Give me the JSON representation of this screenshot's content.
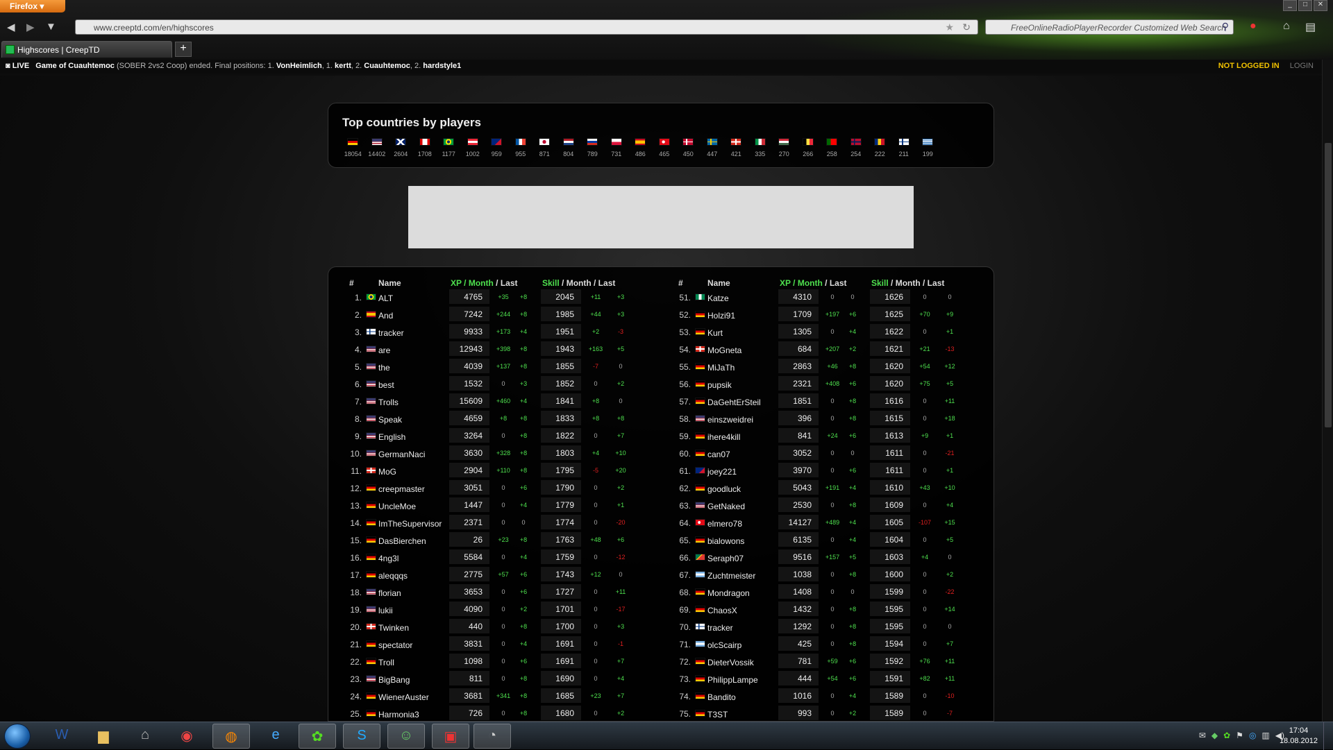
{
  "browser": {
    "menu_label": "Firefox",
    "url": "www.creeptd.com/en/highscores",
    "search_placeholder": "FreeOnlineRadioPlayerRecorder Customized Web Search",
    "tab_title": "Highscores | CreepTD"
  },
  "livebar": {
    "live_label": "LIVE",
    "game_title": "Game of Cuauhtemoc",
    "game_mode": "(SOBER 2vs2 Coop) ended. Final positions: 1.",
    "p1": "VonHeimlich",
    "sep1": ", 1.",
    "p2": "kertt",
    "sep2": ", 2.",
    "p3": "Cuauhtemoc",
    "sep3": ", 2.",
    "p4": "hardstyle1",
    "status": "NOT LOGGED IN",
    "login": "LOGIN"
  },
  "countries": {
    "title": "Top countries by players",
    "items": [
      {
        "flag": "germany",
        "count": "18054"
      },
      {
        "flag": "usa",
        "count": "14402"
      },
      {
        "flag": "uk",
        "count": "2604"
      },
      {
        "flag": "canada",
        "count": "1708"
      },
      {
        "flag": "brazil",
        "count": "1177"
      },
      {
        "flag": "austria",
        "count": "1002"
      },
      {
        "flag": "australia",
        "count": "959"
      },
      {
        "flag": "france",
        "count": "955"
      },
      {
        "flag": "japan",
        "count": "871"
      },
      {
        "flag": "netherlands",
        "count": "804"
      },
      {
        "flag": "russia",
        "count": "789"
      },
      {
        "flag": "poland",
        "count": "731"
      },
      {
        "flag": "spain",
        "count": "486"
      },
      {
        "flag": "turkey",
        "count": "465"
      },
      {
        "flag": "denmark",
        "count": "450"
      },
      {
        "flag": "sweden",
        "count": "447"
      },
      {
        "flag": "switzerland",
        "count": "421"
      },
      {
        "flag": "italy",
        "count": "335"
      },
      {
        "flag": "hungary",
        "count": "270"
      },
      {
        "flag": "belgium",
        "count": "266"
      },
      {
        "flag": "portugal",
        "count": "258"
      },
      {
        "flag": "norway",
        "count": "254"
      },
      {
        "flag": "romania",
        "count": "222"
      },
      {
        "flag": "finland",
        "count": "211"
      },
      {
        "flag": "greece",
        "count": "199"
      }
    ]
  },
  "table_headers": {
    "rank": "#",
    "name": "Name",
    "xp": "XP",
    "slash1": "/",
    "month": "Month",
    "slash2": "/ Last",
    "skill": "Skill",
    "skill_rest": "/ Month / Last"
  },
  "left_rows": [
    {
      "rank": "1.",
      "flag": "brazil",
      "name": "ALT",
      "xp": "4765",
      "xp_month": "+35",
      "xp_last": "+8",
      "skill": "2045",
      "skill_month": "+11",
      "skill_last": "+3"
    },
    {
      "rank": "2.",
      "flag": "spain",
      "name": "And",
      "xp": "7242",
      "xp_month": "+244",
      "xp_last": "+8",
      "skill": "1985",
      "skill_month": "+44",
      "skill_last": "+3"
    },
    {
      "rank": "3.",
      "flag": "finland",
      "name": "tracker",
      "xp": "9933",
      "xp_month": "+173",
      "xp_last": "+4",
      "skill": "1951",
      "skill_month": "+2",
      "skill_last": "-3"
    },
    {
      "rank": "4.",
      "flag": "usa",
      "name": "are",
      "xp": "12943",
      "xp_month": "+398",
      "xp_last": "+8",
      "skill": "1943",
      "skill_month": "+163",
      "skill_last": "+5"
    },
    {
      "rank": "5.",
      "flag": "usa",
      "name": "the",
      "xp": "4039",
      "xp_month": "+137",
      "xp_last": "+8",
      "skill": "1855",
      "skill_month": "-7",
      "skill_last": "0"
    },
    {
      "rank": "6.",
      "flag": "usa",
      "name": "best",
      "xp": "1532",
      "xp_month": "0",
      "xp_last": "+3",
      "skill": "1852",
      "skill_month": "0",
      "skill_last": "+2"
    },
    {
      "rank": "7.",
      "flag": "usa",
      "name": "Trolls",
      "xp": "15609",
      "xp_month": "+460",
      "xp_last": "+4",
      "skill": "1841",
      "skill_month": "+8",
      "skill_last": "0"
    },
    {
      "rank": "8.",
      "flag": "usa",
      "name": "Speak",
      "xp": "4659",
      "xp_month": "+8",
      "xp_last": "+8",
      "skill": "1833",
      "skill_month": "+8",
      "skill_last": "+8"
    },
    {
      "rank": "9.",
      "flag": "usa",
      "name": "English",
      "xp": "3264",
      "xp_month": "0",
      "xp_last": "+8",
      "skill": "1822",
      "skill_month": "0",
      "skill_last": "+7"
    },
    {
      "rank": "10.",
      "flag": "usa",
      "name": "GermanNaci",
      "xp": "3630",
      "xp_month": "+328",
      "xp_last": "+8",
      "skill": "1803",
      "skill_month": "+4",
      "skill_last": "+10"
    },
    {
      "rank": "11.",
      "flag": "switzerland",
      "name": "MoG",
      "xp": "2904",
      "xp_month": "+110",
      "xp_last": "+8",
      "skill": "1795",
      "skill_month": "-5",
      "skill_last": "+20"
    },
    {
      "rank": "12.",
      "flag": "germany",
      "name": "creepmaster",
      "xp": "3051",
      "xp_month": "0",
      "xp_last": "+6",
      "skill": "1790",
      "skill_month": "0",
      "skill_last": "+2"
    },
    {
      "rank": "13.",
      "flag": "germany",
      "name": "UncleMoe",
      "xp": "1447",
      "xp_month": "0",
      "xp_last": "+4",
      "skill": "1779",
      "skill_month": "0",
      "skill_last": "+1"
    },
    {
      "rank": "14.",
      "flag": "germany",
      "name": "ImTheSupervisor",
      "xp": "2371",
      "xp_month": "0",
      "xp_last": "0",
      "skill": "1774",
      "skill_month": "0",
      "skill_last": "-20"
    },
    {
      "rank": "15.",
      "flag": "germany",
      "name": "DasBierchen",
      "xp": "26",
      "xp_month": "+23",
      "xp_last": "+8",
      "skill": "1763",
      "skill_month": "+48",
      "skill_last": "+6"
    },
    {
      "rank": "16.",
      "flag": "germany",
      "name": "4ng3l",
      "xp": "5584",
      "xp_month": "0",
      "xp_last": "+4",
      "skill": "1759",
      "skill_month": "0",
      "skill_last": "-12"
    },
    {
      "rank": "17.",
      "flag": "germany",
      "name": "aleqqqs",
      "xp": "2775",
      "xp_month": "+57",
      "xp_last": "+6",
      "skill": "1743",
      "skill_month": "+12",
      "skill_last": "0"
    },
    {
      "rank": "18.",
      "flag": "usa",
      "name": "florian",
      "xp": "3653",
      "xp_month": "0",
      "xp_last": "+6",
      "skill": "1727",
      "skill_month": "0",
      "skill_last": "+11"
    },
    {
      "rank": "19.",
      "flag": "usa",
      "name": "lukii",
      "xp": "4090",
      "xp_month": "0",
      "xp_last": "+2",
      "skill": "1701",
      "skill_month": "0",
      "skill_last": "-17"
    },
    {
      "rank": "20.",
      "flag": "switzerland",
      "name": "Twinken",
      "xp": "440",
      "xp_month": "0",
      "xp_last": "+8",
      "skill": "1700",
      "skill_month": "0",
      "skill_last": "+3"
    },
    {
      "rank": "21.",
      "flag": "germany",
      "name": "spectator",
      "xp": "3831",
      "xp_month": "0",
      "xp_last": "+4",
      "skill": "1691",
      "skill_month": "0",
      "skill_last": "-1"
    },
    {
      "rank": "22.",
      "flag": "germany",
      "name": "Troll",
      "xp": "1098",
      "xp_month": "0",
      "xp_last": "+6",
      "skill": "1691",
      "skill_month": "0",
      "skill_last": "+7"
    },
    {
      "rank": "23.",
      "flag": "usa",
      "name": "BigBang",
      "xp": "811",
      "xp_month": "0",
      "xp_last": "+8",
      "skill": "1690",
      "skill_month": "0",
      "skill_last": "+4"
    },
    {
      "rank": "24.",
      "flag": "germany",
      "name": "WienerAuster",
      "xp": "3681",
      "xp_month": "+341",
      "xp_last": "+8",
      "skill": "1685",
      "skill_month": "+23",
      "skill_last": "+7"
    },
    {
      "rank": "25.",
      "flag": "germany",
      "name": "Harmonia3",
      "xp": "726",
      "xp_month": "0",
      "xp_last": "+8",
      "skill": "1680",
      "skill_month": "0",
      "skill_last": "+2"
    }
  ],
  "right_rows": [
    {
      "rank": "51.",
      "flag": "nigeria",
      "name": "Katze",
      "xp": "4310",
      "xp_month": "0",
      "xp_last": "0",
      "skill": "1626",
      "skill_month": "0",
      "skill_last": "0"
    },
    {
      "rank": "52.",
      "flag": "germany",
      "name": "Holzi91",
      "xp": "1709",
      "xp_month": "+197",
      "xp_last": "+6",
      "skill": "1625",
      "skill_month": "+70",
      "skill_last": "+9"
    },
    {
      "rank": "53.",
      "flag": "germany",
      "name": "Kurt",
      "xp": "1305",
      "xp_month": "0",
      "xp_last": "+4",
      "skill": "1622",
      "skill_month": "0",
      "skill_last": "+1"
    },
    {
      "rank": "54.",
      "flag": "switzerland",
      "name": "MoGneta",
      "xp": "684",
      "xp_month": "+207",
      "xp_last": "+2",
      "skill": "1621",
      "skill_month": "+21",
      "skill_last": "-13"
    },
    {
      "rank": "55.",
      "flag": "germany",
      "name": "MiJaTh",
      "xp": "2863",
      "xp_month": "+46",
      "xp_last": "+8",
      "skill": "1620",
      "skill_month": "+54",
      "skill_last": "+12"
    },
    {
      "rank": "56.",
      "flag": "germany",
      "name": "pupsik",
      "xp": "2321",
      "xp_month": "+408",
      "xp_last": "+6",
      "skill": "1620",
      "skill_month": "+75",
      "skill_last": "+5"
    },
    {
      "rank": "57.",
      "flag": "germany",
      "name": "DaGehtErSteil",
      "xp": "1851",
      "xp_month": "0",
      "xp_last": "+8",
      "skill": "1616",
      "skill_month": "0",
      "skill_last": "+11"
    },
    {
      "rank": "58.",
      "flag": "usa",
      "name": "einszweidrei",
      "xp": "396",
      "xp_month": "0",
      "xp_last": "+8",
      "skill": "1615",
      "skill_month": "0",
      "skill_last": "+18"
    },
    {
      "rank": "59.",
      "flag": "germany",
      "name": "ihere4kill",
      "xp": "841",
      "xp_month": "+24",
      "xp_last": "+6",
      "skill": "1613",
      "skill_month": "+9",
      "skill_last": "+1"
    },
    {
      "rank": "60.",
      "flag": "germany",
      "name": "can07",
      "xp": "3052",
      "xp_month": "0",
      "xp_last": "0",
      "skill": "1611",
      "skill_month": "0",
      "skill_last": "-21"
    },
    {
      "rank": "61.",
      "flag": "australia",
      "name": "joey221",
      "xp": "3970",
      "xp_month": "0",
      "xp_last": "+6",
      "skill": "1611",
      "skill_month": "0",
      "skill_last": "+1"
    },
    {
      "rank": "62.",
      "flag": "germany",
      "name": "goodluck",
      "xp": "5043",
      "xp_month": "+191",
      "xp_last": "+4",
      "skill": "1610",
      "skill_month": "+43",
      "skill_last": "+10"
    },
    {
      "rank": "63.",
      "flag": "usa",
      "name": "GetNaked",
      "xp": "2530",
      "xp_month": "0",
      "xp_last": "+8",
      "skill": "1609",
      "skill_month": "0",
      "skill_last": "+4"
    },
    {
      "rank": "64.",
      "flag": "turkey",
      "name": "elmero78",
      "xp": "14127",
      "xp_month": "+489",
      "xp_last": "+4",
      "skill": "1605",
      "skill_month": "-107",
      "skill_last": "+15"
    },
    {
      "rank": "65.",
      "flag": "germany",
      "name": "bialowons",
      "xp": "6135",
      "xp_month": "0",
      "xp_last": "+4",
      "skill": "1604",
      "skill_month": "0",
      "skill_last": "+5"
    },
    {
      "rank": "66.",
      "flag": "southafrica",
      "name": "Seraph07",
      "xp": "9516",
      "xp_month": "+157",
      "xp_last": "+5",
      "skill": "1603",
      "skill_month": "+4",
      "skill_last": "0"
    },
    {
      "rank": "67.",
      "flag": "argentina",
      "name": "Zuchtmeister",
      "xp": "1038",
      "xp_month": "0",
      "xp_last": "+8",
      "skill": "1600",
      "skill_month": "0",
      "skill_last": "+2"
    },
    {
      "rank": "68.",
      "flag": "germany",
      "name": "Mondragon",
      "xp": "1408",
      "xp_month": "0",
      "xp_last": "0",
      "skill": "1599",
      "skill_month": "0",
      "skill_last": "-22"
    },
    {
      "rank": "69.",
      "flag": "germany",
      "name": "ChaosX",
      "xp": "1432",
      "xp_month": "0",
      "xp_last": "+8",
      "skill": "1595",
      "skill_month": "0",
      "skill_last": "+14"
    },
    {
      "rank": "70.",
      "flag": "finland",
      "name": "tracker",
      "xp": "1292",
      "xp_month": "0",
      "xp_last": "+8",
      "skill": "1595",
      "skill_month": "0",
      "skill_last": "0"
    },
    {
      "rank": "71.",
      "flag": "argentina",
      "name": "olcScairp",
      "xp": "425",
      "xp_month": "0",
      "xp_last": "+8",
      "skill": "1594",
      "skill_month": "0",
      "skill_last": "+7"
    },
    {
      "rank": "72.",
      "flag": "germany",
      "name": "DieterVossik",
      "xp": "781",
      "xp_month": "+59",
      "xp_last": "+6",
      "skill": "1592",
      "skill_month": "+76",
      "skill_last": "+11"
    },
    {
      "rank": "73.",
      "flag": "germany",
      "name": "PhilippLampe",
      "xp": "444",
      "xp_month": "+54",
      "xp_last": "+6",
      "skill": "1591",
      "skill_month": "+82",
      "skill_last": "+11"
    },
    {
      "rank": "74.",
      "flag": "germany",
      "name": "Bandito",
      "xp": "1016",
      "xp_month": "0",
      "xp_last": "+4",
      "skill": "1589",
      "skill_month": "0",
      "skill_last": "-10"
    },
    {
      "rank": "75.",
      "flag": "germany",
      "name": "T3ST",
      "xp": "993",
      "xp_month": "0",
      "xp_last": "+2",
      "skill": "1589",
      "skill_month": "0",
      "skill_last": "-7"
    }
  ],
  "taskbar": {
    "apps": [
      "start-orb",
      "word-icon",
      "explorer-icon",
      "scanner-icon",
      "chrome-icon",
      "firefox-icon",
      "ie-icon",
      "icq-icon",
      "skype-icon",
      "messenger-icon",
      "creeptd-icon",
      "dialer-icon"
    ],
    "time": "17:04",
    "date": "18.08.2012"
  },
  "colors": {
    "positive": "#4ee04e",
    "negative": "#e02020",
    "accent_gold": "#f2c200"
  }
}
